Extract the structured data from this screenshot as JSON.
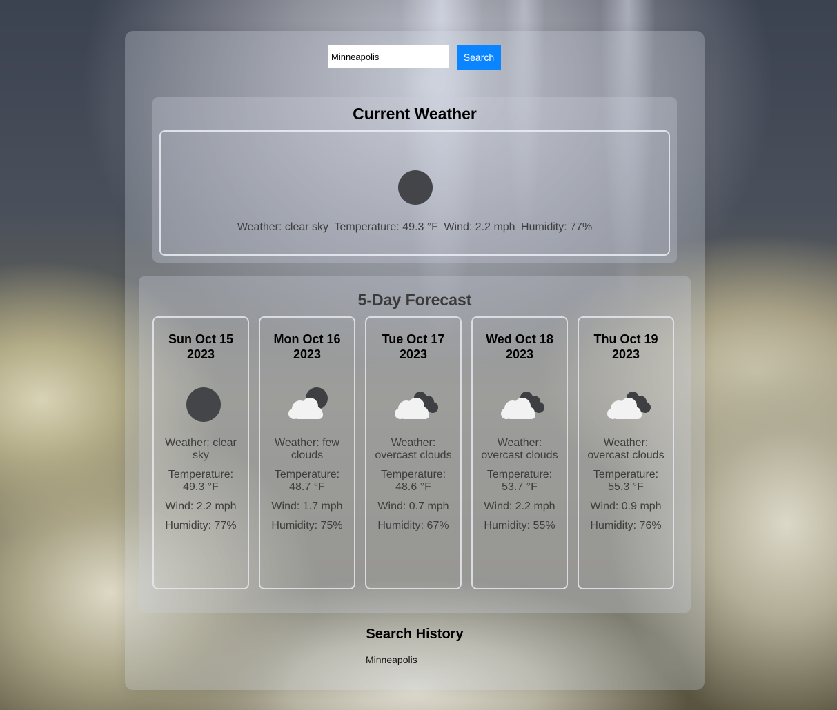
{
  "search": {
    "value": "Minneapolis",
    "button_label": "Search"
  },
  "current": {
    "title": "Current Weather",
    "icon": "moon-clear-icon",
    "weather": "Weather: clear sky",
    "temperature": "Temperature: 49.3 °F",
    "wind": "Wind: 2.2 mph",
    "humidity": "Humidity: 77%"
  },
  "forecast": {
    "title": "5-Day Forecast",
    "days": [
      {
        "date": "Sun Oct 15 2023",
        "icon": "moon-clear-icon",
        "weather": "Weather: clear sky",
        "temperature": "Temperature: 49.3 °F",
        "wind": "Wind: 2.2 mph",
        "humidity": "Humidity: 77%"
      },
      {
        "date": "Mon Oct 16 2023",
        "icon": "few-clouds-night-icon",
        "weather": "Weather: few clouds",
        "temperature": "Temperature: 48.7 °F",
        "wind": "Wind: 1.7 mph",
        "humidity": "Humidity: 75%"
      },
      {
        "date": "Tue Oct 17 2023",
        "icon": "overcast-clouds-icon",
        "weather": "Weather: overcast clouds",
        "temperature": "Temperature: 48.6 °F",
        "wind": "Wind: 0.7 mph",
        "humidity": "Humidity: 67%"
      },
      {
        "date": "Wed Oct 18 2023",
        "icon": "overcast-clouds-icon",
        "weather": "Weather: overcast clouds",
        "temperature": "Temperature: 53.7 °F",
        "wind": "Wind: 2.2 mph",
        "humidity": "Humidity: 55%"
      },
      {
        "date": "Thu Oct 19 2023",
        "icon": "overcast-clouds-icon",
        "weather": "Weather: overcast clouds",
        "temperature": "Temperature: 55.3 °F",
        "wind": "Wind: 0.9 mph",
        "humidity": "Humidity: 76%"
      }
    ]
  },
  "history": {
    "title": "Search History",
    "items": [
      "Minneapolis"
    ]
  },
  "colors": {
    "search_button": "#0b84ff",
    "moon": "#444548",
    "cloud": "#f2f2f2",
    "dark_cloud": "#3e3f42"
  }
}
